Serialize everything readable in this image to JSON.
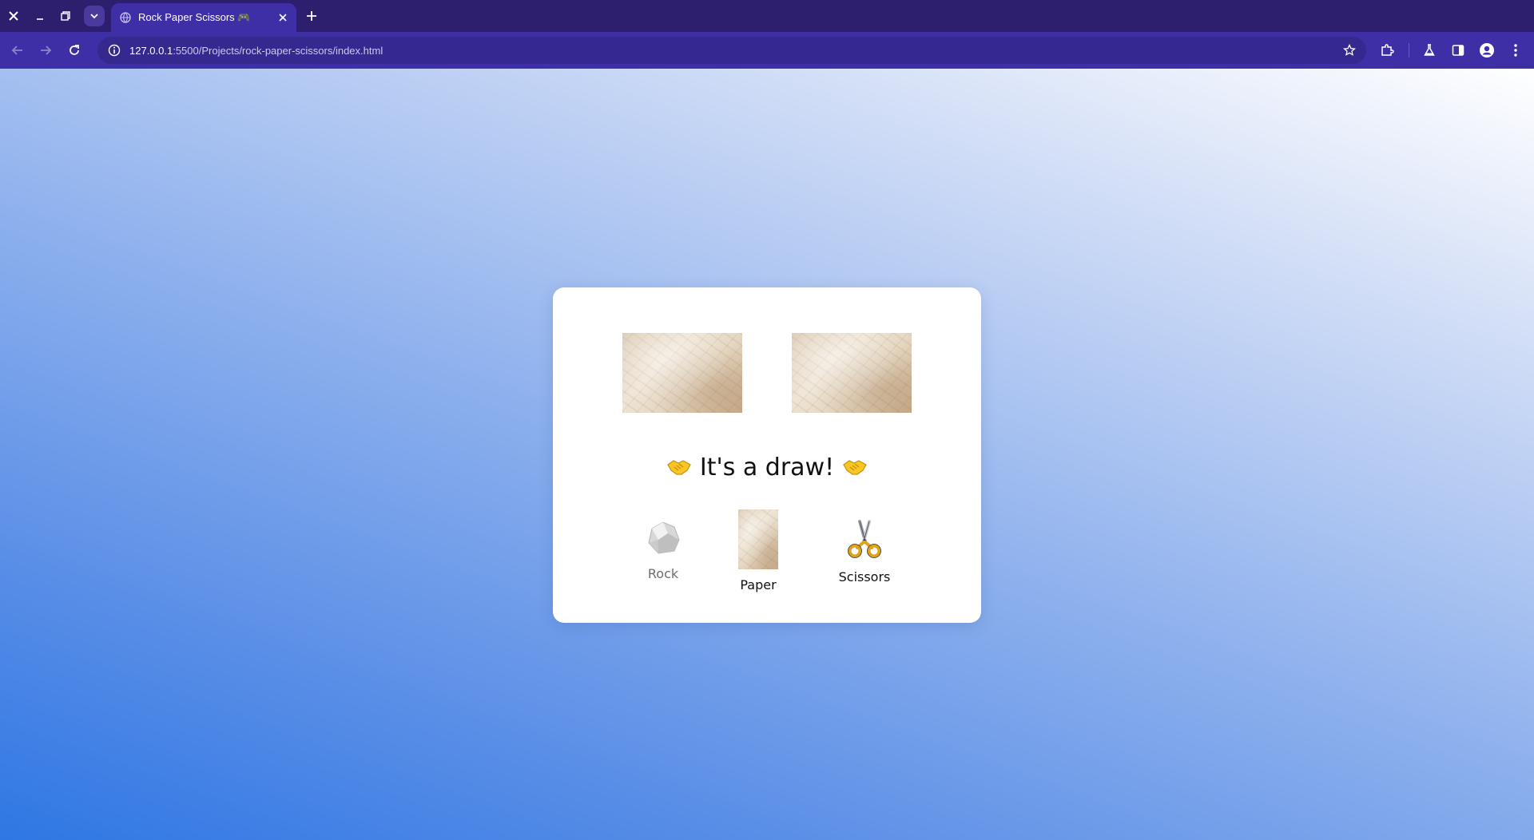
{
  "browser": {
    "tab_title": "Rock Paper Scissors 🎮",
    "url_host": "127.0.0.1",
    "url_path": ":5500/Projects/rock-paper-scissors/index.html",
    "colors": {
      "titlebar": "#2d1f6e",
      "toolbar": "#3f2fa6",
      "omnibox": "#35288e"
    }
  },
  "game": {
    "user_choice_image": "paper-image",
    "computer_choice_image": "paper-image",
    "result_emoji": "🤝",
    "result_text": "It's a draw!",
    "options": [
      {
        "label": "Rock",
        "icon": "rock-icon"
      },
      {
        "label": "Paper",
        "icon": "paper-icon"
      },
      {
        "label": "Scissors",
        "icon": "scissors-icon"
      }
    ]
  },
  "page": {
    "gradient_top": "#ffffff",
    "gradient_bottom": "#2f77e4",
    "card_color": "#ffffff"
  }
}
